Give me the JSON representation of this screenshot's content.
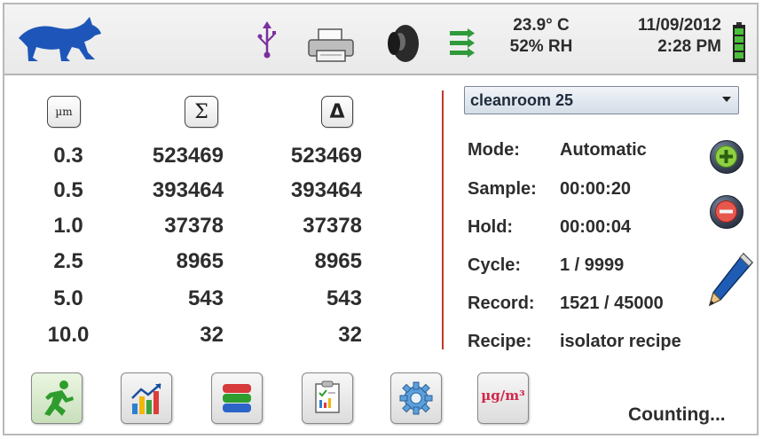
{
  "status_bar": {
    "temperature": "23.9° C",
    "humidity": "52% RH",
    "date": "11/09/2012",
    "time": "2:28 PM",
    "icons": [
      "wolf-logo",
      "usb-icon",
      "printer-icon",
      "speaker-icon",
      "transfer-arrows-icon",
      "battery-icon"
    ]
  },
  "counts": {
    "header_size": "µm",
    "header_cumulative": "Σ",
    "header_differential": "Δ",
    "rows": [
      {
        "size": "0.3",
        "cumulative": "523469",
        "differential": "523469"
      },
      {
        "size": "0.5",
        "cumulative": "393464",
        "differential": "393464"
      },
      {
        "size": "1.0",
        "cumulative": "37378",
        "differential": "37378"
      },
      {
        "size": "2.5",
        "cumulative": "8965",
        "differential": "8965"
      },
      {
        "size": "5.0",
        "cumulative": "543",
        "differential": "543"
      },
      {
        "size": "10.0",
        "cumulative": "32",
        "differential": "32"
      }
    ]
  },
  "settings": {
    "location_selected": "cleanroom 25",
    "mode_label": "Mode:",
    "mode_value": "Automatic",
    "sample_label": "Sample:",
    "sample_value": "00:00:20",
    "hold_label": "Hold:",
    "hold_value": "00:00:04",
    "cycle_label": "Cycle:",
    "cycle_value": "1 / 9999",
    "record_label": "Record:",
    "record_value": "1521 / 45000",
    "recipe_label": "Recipe:",
    "recipe_value": "isolator recipe"
  },
  "toolbar": {
    "buttons": [
      "run-icon",
      "chart-icon",
      "database-icon",
      "report-icon",
      "settings-gear-icon",
      "mass-concentration-icon"
    ],
    "mass_label": "µg/m³"
  },
  "status_text": "Counting...",
  "colors": {
    "divider": "#c0392b",
    "run_green": "#2e9d2e",
    "mass_label": "#d0264a"
  }
}
